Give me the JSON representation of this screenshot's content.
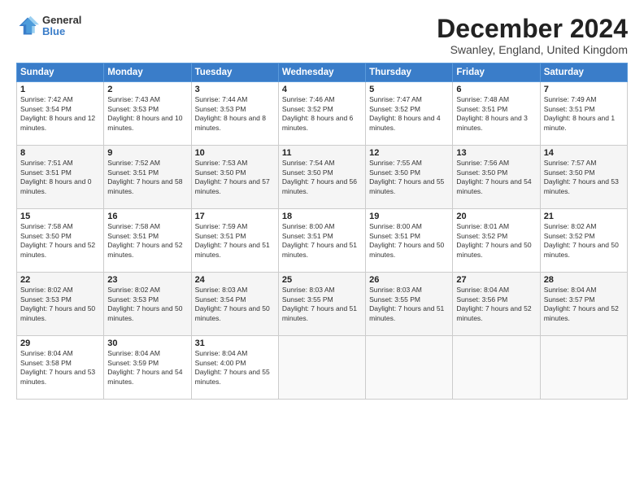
{
  "logo": {
    "general": "General",
    "blue": "Blue"
  },
  "title": "December 2024",
  "subtitle": "Swanley, England, United Kingdom",
  "days_of_week": [
    "Sunday",
    "Monday",
    "Tuesday",
    "Wednesday",
    "Thursday",
    "Friday",
    "Saturday"
  ],
  "weeks": [
    [
      {
        "day": "1",
        "sunrise": "Sunrise: 7:42 AM",
        "sunset": "Sunset: 3:54 PM",
        "daylight": "Daylight: 8 hours and 12 minutes."
      },
      {
        "day": "2",
        "sunrise": "Sunrise: 7:43 AM",
        "sunset": "Sunset: 3:53 PM",
        "daylight": "Daylight: 8 hours and 10 minutes."
      },
      {
        "day": "3",
        "sunrise": "Sunrise: 7:44 AM",
        "sunset": "Sunset: 3:53 PM",
        "daylight": "Daylight: 8 hours and 8 minutes."
      },
      {
        "day": "4",
        "sunrise": "Sunrise: 7:46 AM",
        "sunset": "Sunset: 3:52 PM",
        "daylight": "Daylight: 8 hours and 6 minutes."
      },
      {
        "day": "5",
        "sunrise": "Sunrise: 7:47 AM",
        "sunset": "Sunset: 3:52 PM",
        "daylight": "Daylight: 8 hours and 4 minutes."
      },
      {
        "day": "6",
        "sunrise": "Sunrise: 7:48 AM",
        "sunset": "Sunset: 3:51 PM",
        "daylight": "Daylight: 8 hours and 3 minutes."
      },
      {
        "day": "7",
        "sunrise": "Sunrise: 7:49 AM",
        "sunset": "Sunset: 3:51 PM",
        "daylight": "Daylight: 8 hours and 1 minute."
      }
    ],
    [
      {
        "day": "8",
        "sunrise": "Sunrise: 7:51 AM",
        "sunset": "Sunset: 3:51 PM",
        "daylight": "Daylight: 8 hours and 0 minutes."
      },
      {
        "day": "9",
        "sunrise": "Sunrise: 7:52 AM",
        "sunset": "Sunset: 3:51 PM",
        "daylight": "Daylight: 7 hours and 58 minutes."
      },
      {
        "day": "10",
        "sunrise": "Sunrise: 7:53 AM",
        "sunset": "Sunset: 3:50 PM",
        "daylight": "Daylight: 7 hours and 57 minutes."
      },
      {
        "day": "11",
        "sunrise": "Sunrise: 7:54 AM",
        "sunset": "Sunset: 3:50 PM",
        "daylight": "Daylight: 7 hours and 56 minutes."
      },
      {
        "day": "12",
        "sunrise": "Sunrise: 7:55 AM",
        "sunset": "Sunset: 3:50 PM",
        "daylight": "Daylight: 7 hours and 55 minutes."
      },
      {
        "day": "13",
        "sunrise": "Sunrise: 7:56 AM",
        "sunset": "Sunset: 3:50 PM",
        "daylight": "Daylight: 7 hours and 54 minutes."
      },
      {
        "day": "14",
        "sunrise": "Sunrise: 7:57 AM",
        "sunset": "Sunset: 3:50 PM",
        "daylight": "Daylight: 7 hours and 53 minutes."
      }
    ],
    [
      {
        "day": "15",
        "sunrise": "Sunrise: 7:58 AM",
        "sunset": "Sunset: 3:50 PM",
        "daylight": "Daylight: 7 hours and 52 minutes."
      },
      {
        "day": "16",
        "sunrise": "Sunrise: 7:58 AM",
        "sunset": "Sunset: 3:51 PM",
        "daylight": "Daylight: 7 hours and 52 minutes."
      },
      {
        "day": "17",
        "sunrise": "Sunrise: 7:59 AM",
        "sunset": "Sunset: 3:51 PM",
        "daylight": "Daylight: 7 hours and 51 minutes."
      },
      {
        "day": "18",
        "sunrise": "Sunrise: 8:00 AM",
        "sunset": "Sunset: 3:51 PM",
        "daylight": "Daylight: 7 hours and 51 minutes."
      },
      {
        "day": "19",
        "sunrise": "Sunrise: 8:00 AM",
        "sunset": "Sunset: 3:51 PM",
        "daylight": "Daylight: 7 hours and 50 minutes."
      },
      {
        "day": "20",
        "sunrise": "Sunrise: 8:01 AM",
        "sunset": "Sunset: 3:52 PM",
        "daylight": "Daylight: 7 hours and 50 minutes."
      },
      {
        "day": "21",
        "sunrise": "Sunrise: 8:02 AM",
        "sunset": "Sunset: 3:52 PM",
        "daylight": "Daylight: 7 hours and 50 minutes."
      }
    ],
    [
      {
        "day": "22",
        "sunrise": "Sunrise: 8:02 AM",
        "sunset": "Sunset: 3:53 PM",
        "daylight": "Daylight: 7 hours and 50 minutes."
      },
      {
        "day": "23",
        "sunrise": "Sunrise: 8:02 AM",
        "sunset": "Sunset: 3:53 PM",
        "daylight": "Daylight: 7 hours and 50 minutes."
      },
      {
        "day": "24",
        "sunrise": "Sunrise: 8:03 AM",
        "sunset": "Sunset: 3:54 PM",
        "daylight": "Daylight: 7 hours and 50 minutes."
      },
      {
        "day": "25",
        "sunrise": "Sunrise: 8:03 AM",
        "sunset": "Sunset: 3:55 PM",
        "daylight": "Daylight: 7 hours and 51 minutes."
      },
      {
        "day": "26",
        "sunrise": "Sunrise: 8:03 AM",
        "sunset": "Sunset: 3:55 PM",
        "daylight": "Daylight: 7 hours and 51 minutes."
      },
      {
        "day": "27",
        "sunrise": "Sunrise: 8:04 AM",
        "sunset": "Sunset: 3:56 PM",
        "daylight": "Daylight: 7 hours and 52 minutes."
      },
      {
        "day": "28",
        "sunrise": "Sunrise: 8:04 AM",
        "sunset": "Sunset: 3:57 PM",
        "daylight": "Daylight: 7 hours and 52 minutes."
      }
    ],
    [
      {
        "day": "29",
        "sunrise": "Sunrise: 8:04 AM",
        "sunset": "Sunset: 3:58 PM",
        "daylight": "Daylight: 7 hours and 53 minutes."
      },
      {
        "day": "30",
        "sunrise": "Sunrise: 8:04 AM",
        "sunset": "Sunset: 3:59 PM",
        "daylight": "Daylight: 7 hours and 54 minutes."
      },
      {
        "day": "31",
        "sunrise": "Sunrise: 8:04 AM",
        "sunset": "Sunset: 4:00 PM",
        "daylight": "Daylight: 7 hours and 55 minutes."
      },
      null,
      null,
      null,
      null
    ]
  ]
}
